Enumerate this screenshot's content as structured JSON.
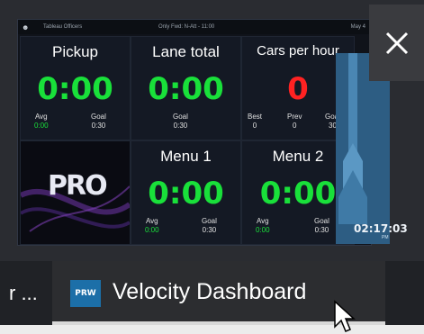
{
  "header": {
    "logo": "☻",
    "store": "Tableau Officers",
    "date": "Only Fwd: N-Att - 11:00",
    "day": "May 4"
  },
  "tiles": {
    "pickup": {
      "title": "Pickup",
      "value": "0:00",
      "avg_label": "Avg",
      "avg_value": "0:00",
      "goal_label": "Goal",
      "goal_value": "0:30"
    },
    "lane_total": {
      "title": "Lane total",
      "value": "0:00",
      "goal_label": "Goal",
      "goal_value": "0:30"
    },
    "cars_per_hour": {
      "title": "Cars per hour",
      "value": "0",
      "best_label": "Best",
      "best_value": "0",
      "prev_label": "Prev",
      "prev_value": "0",
      "goal_label": "Goal",
      "goal_value": "30"
    },
    "menu1": {
      "title": "Menu 1",
      "value": "0:00",
      "avg_label": "Avg",
      "avg_value": "0:00",
      "goal_label": "Goal",
      "goal_value": "0:30"
    },
    "menu2": {
      "title": "Menu 2",
      "value": "0:00",
      "avg_label": "Avg",
      "avg_value": "0:00",
      "goal_label": "Goal",
      "goal_value": "0:30"
    },
    "pro_logo": "PRO"
  },
  "side": {
    "clock": "02:17:03",
    "ampm": "PM"
  },
  "close_icon": "close-icon",
  "taskbar": {
    "previous_label": "r ...",
    "app_icon_text": "PRW",
    "app_label": "Velocity Dashboard"
  },
  "colors": {
    "green": "#19e03a",
    "red": "#ff2222",
    "accent": "#1c6fa8"
  }
}
